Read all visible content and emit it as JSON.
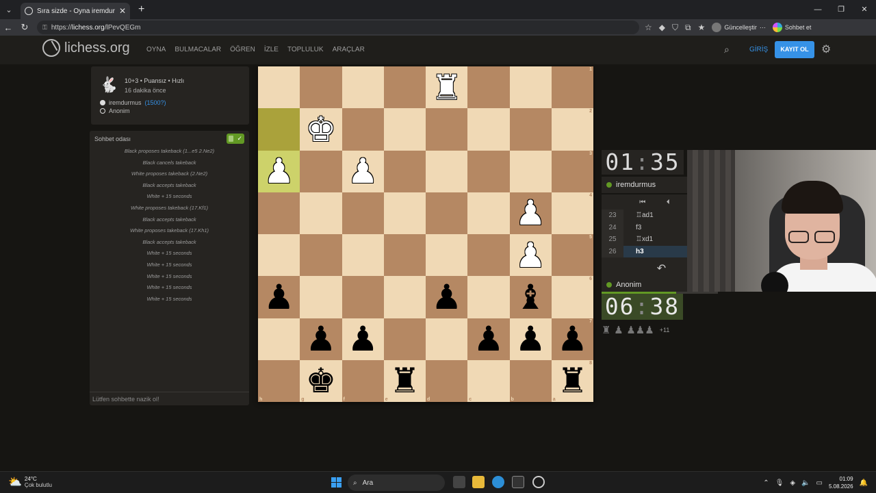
{
  "browser": {
    "tab_title": "Sıra sizde - Oyna iremdurmus",
    "url_prefix": "https://",
    "url_host": "lichess.org",
    "url_path": "/lPevQEGm",
    "update_label": "Güncelleştir",
    "chat_label": "Sohbet et"
  },
  "header": {
    "logo_text": "lichess.org",
    "nav": [
      "OYNA",
      "BULMACALAR",
      "ÖĞREN",
      "İZLE",
      "TOPLULUK",
      "ARAÇLAR"
    ],
    "login": "GİRİŞ",
    "signup": "KAYIT OL"
  },
  "game_info": {
    "line1": "10+3 • Puansız • Hızlı",
    "line2": "16 dakika önce",
    "white_player": "iremdurmus",
    "white_rating": "(1500?)",
    "black_player": "Anonim"
  },
  "chat": {
    "title": "Sohbet odası",
    "messages": [
      "Black proposes takeback (1...e5 2.Ne2)",
      "Black cancels takeback",
      "White proposes takeback (2.Ne2)",
      "Black accepts takeback",
      "White + 15 seconds",
      "White proposes takeback (17.Kf1)",
      "Black accepts takeback",
      "White proposes takeback (17.Kh1)",
      "Black accepts takeback",
      "White + 15 seconds",
      "White + 15 seconds",
      "White + 15 seconds",
      "White + 15 seconds",
      "White + 15 seconds"
    ],
    "input_placeholder": "Lütfen sohbette nazik ol!"
  },
  "board": {
    "ranks": [
      [
        "",
        "",
        "",
        "",
        "♜w",
        "",
        "",
        ""
      ],
      [
        "",
        "♚w",
        "",
        "",
        "",
        "",
        "",
        ""
      ],
      [
        "♟w",
        "",
        "♟w",
        "",
        "",
        "",
        "",
        ""
      ],
      [
        "",
        "",
        "",
        "",
        "",
        "",
        "♟w",
        ""
      ],
      [
        "",
        "",
        "",
        "",
        "",
        "",
        "♟w",
        ""
      ],
      [
        "♟b",
        "",
        "",
        "",
        "♟b",
        "",
        "♝b",
        ""
      ],
      [
        "",
        "♟b",
        "♟b",
        "",
        "",
        "♟b",
        "♟b",
        "♟b"
      ],
      [
        "",
        "♚b",
        "",
        "♜b",
        "",
        "",
        "",
        "♜b"
      ]
    ],
    "rank_labels": [
      "1",
      "2",
      "3",
      "4",
      "5",
      "6",
      "7",
      "8"
    ],
    "file_labels": [
      "h",
      "g",
      "f",
      "e",
      "d",
      "c",
      "b",
      "a"
    ],
    "highlight_last_move": [
      [
        1,
        0
      ],
      [
        2,
        0
      ]
    ]
  },
  "clocks": {
    "top": {
      "min": "01",
      "sec": "35",
      "player": "iremdurmus"
    },
    "bottom": {
      "min": "06",
      "sec": "38",
      "player": "Anonim"
    },
    "bottom_time_fraction": 0.64
  },
  "moves": [
    {
      "no": "23",
      "san": "♖ad1"
    },
    {
      "no": "24",
      "san": "f3"
    },
    {
      "no": "25",
      "san": "♖xd1"
    },
    {
      "no": "26",
      "san": "h3"
    }
  ],
  "captured": {
    "pieces": "♜ ♟ ♟♟♟",
    "plus": "+11"
  },
  "taskbar": {
    "temp": "24°C",
    "weather": "Çok bulutlu",
    "search": "Ara",
    "time": "01:09",
    "date": "5.08.2026"
  },
  "colors": {
    "accent": "#3692e7",
    "online": "#629924",
    "board_light": "#f0d9b5",
    "board_dark": "#b58863"
  }
}
